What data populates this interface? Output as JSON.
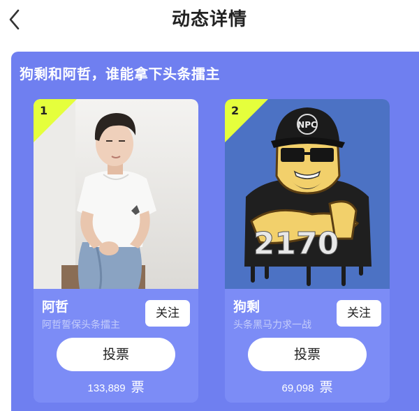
{
  "header": {
    "title": "动态详情",
    "back_icon": "chevron-left-icon"
  },
  "panel": {
    "title": "狗剩和阿哲，谁能拿下头条擂主",
    "background": "#6f7ff0",
    "card_background": "#7c8cf6",
    "flag_color": "#e5ff3c"
  },
  "candidates": [
    {
      "rank": "1",
      "name": "阿哲",
      "desc": "阿哲誓保头条擂主",
      "follow_label": "关注",
      "vote_label": "投票",
      "votes": "133,889",
      "votes_unit": "票",
      "photo": "young-man-portrait"
    },
    {
      "rank": "2",
      "name": "狗剩",
      "desc": "头条黑马力求一战",
      "follow_label": "关注",
      "vote_label": "投票",
      "votes": "69,098",
      "votes_unit": "票",
      "photo": "cartoon-avatar",
      "cap_text": "NPC",
      "shirt_text": "2170"
    }
  ]
}
